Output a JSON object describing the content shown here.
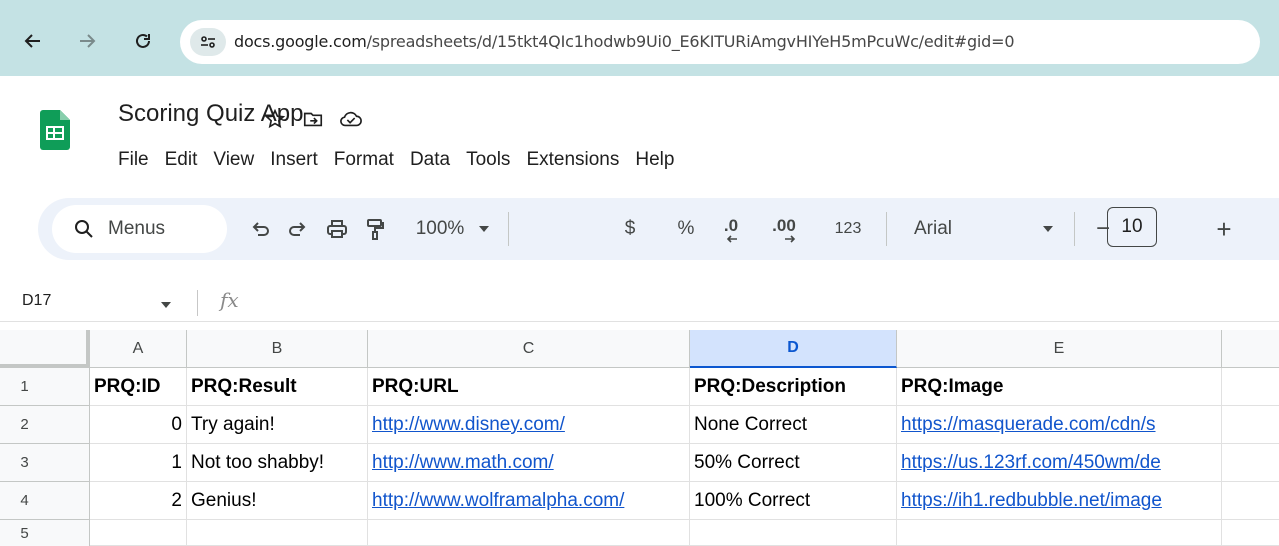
{
  "browser": {
    "url_domain": "docs.google.com",
    "url_path": "/spreadsheets/d/15tkt4QIc1hodwb9Ui0_E6KITURiAmgvHIYeH5mPcuWc/edit#gid=0"
  },
  "doc": {
    "title": "Scoring Quiz App"
  },
  "menu": [
    "File",
    "Edit",
    "View",
    "Insert",
    "Format",
    "Data",
    "Tools",
    "Extensions",
    "Help"
  ],
  "toolbar": {
    "search_label": "Menus",
    "zoom": "100%",
    "currency": "$",
    "percent": "%",
    "decrease_decimal": ".0",
    "increase_decimal": ".00",
    "number_format": "123",
    "font": "Arial",
    "font_size": "10",
    "minus": "−",
    "plus": "+"
  },
  "formula_bar": {
    "cell_ref": "D17",
    "fx": "fx",
    "value": ""
  },
  "grid": {
    "columns": [
      "A",
      "B",
      "C",
      "D",
      "E"
    ],
    "selected_column": "D",
    "rows": [
      {
        "num": "1",
        "cells": [
          "PRQ:ID",
          "PRQ:Result",
          "PRQ:URL",
          "PRQ:Description",
          "PRQ:Image"
        ]
      },
      {
        "num": "2",
        "cells": [
          "0",
          "Try again!",
          "http://www.disney.com/",
          "None Correct",
          "https://masquerade.com/cdn/s"
        ]
      },
      {
        "num": "3",
        "cells": [
          "1",
          "Not too shabby!",
          "http://www.math.com/",
          "50% Correct",
          "https://us.123rf.com/450wm/de"
        ]
      },
      {
        "num": "4",
        "cells": [
          "2",
          "Genius!",
          "http://www.wolframalpha.com/",
          "100% Correct",
          "https://ih1.redbubble.net/image"
        ]
      },
      {
        "num": "5",
        "cells": [
          "",
          "",
          "",
          "",
          ""
        ]
      }
    ]
  },
  "colors": {
    "urlbar_bg": "#c4e2e4",
    "toolbar_bg": "#edf2fa",
    "sheets_green": "#0f9d58",
    "link": "#1155cc",
    "selected_col": "#d3e3fd"
  }
}
